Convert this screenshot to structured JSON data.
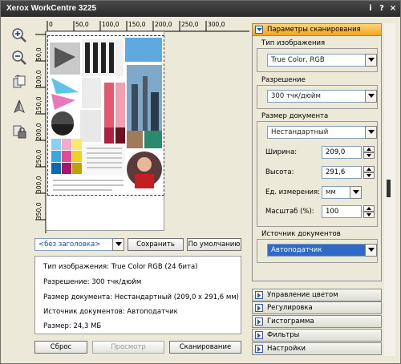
{
  "window": {
    "title": "Xerox WorkCentre 3225",
    "help_label": "?",
    "info_label": "i",
    "close_label": "×"
  },
  "toolbar": [
    "zoom-in-icon",
    "zoom-out-icon",
    "rotate-icon",
    "crop-icon",
    "lock-icon"
  ],
  "ruler": {
    "top_ticks": [
      "0",
      "50,0",
      "100,0",
      "150,0",
      "200,0",
      "250,0",
      "300,0"
    ],
    "left_ticks": [
      "50,0",
      "100,0",
      "150,0",
      "200,0",
      "250,0",
      "300,0",
      "350,0"
    ]
  },
  "preset": {
    "value": "<без заголовка>",
    "save_label": "Сохранить",
    "default_label": "По умолчанию"
  },
  "info": {
    "image_type": "Тип изображения: True Color RGB (24 бита)",
    "resolution": "Разрешение: 300 тчк/дюйм",
    "doc_size": "Размер документа: Нестандартный (209,0 x 291,6 мм)",
    "source": "Источник документов: Автоподатчик",
    "size": "Размер: 24,3 МБ"
  },
  "buttons": {
    "reset": "Сброс",
    "preview": "Просмотр",
    "scan": "Сканирование"
  },
  "panel": {
    "header": "Параметры сканирования",
    "image_type_label": "Тип изображения",
    "image_type_value": "True Color, RGB",
    "resolution_label": "Разрешение",
    "resolution_value": "300 тчк/дюйм",
    "doc_size_label": "Размер документа",
    "doc_size_value": "Нестандартный",
    "width_label": "Ширина:",
    "width_value": "209,0",
    "height_label": "Высота:",
    "height_value": "291,6",
    "units_label": "Ед. измерения:",
    "units_value": "мм",
    "scale_label": "Масштаб (%):",
    "scale_value": "100",
    "source_label": "Источник документов",
    "source_value": "Автоподатчик"
  },
  "sections": [
    "Управление цветом",
    "Регулировка",
    "Гистограмма",
    "Фильтры",
    "Настройки"
  ]
}
